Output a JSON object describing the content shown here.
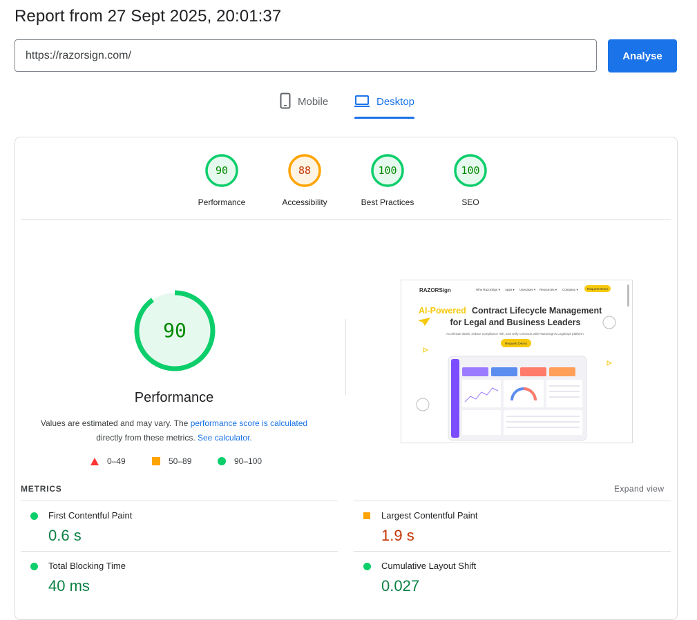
{
  "header": {
    "title": "Report from 27 Sept 2025, 20:01:37",
    "url_value": "https://razorsign.com/",
    "analyse_label": "Analyse"
  },
  "tabs": [
    {
      "label": "Mobile",
      "icon": "phone-icon",
      "active": false
    },
    {
      "label": "Desktop",
      "icon": "laptop-icon",
      "active": true
    }
  ],
  "scores": [
    {
      "label": "Performance",
      "value": "90",
      "status": "pass",
      "color": "#0cce6b"
    },
    {
      "label": "Accessibility",
      "value": "88",
      "status": "average",
      "color": "#ffa400"
    },
    {
      "label": "Best Practices",
      "value": "100",
      "status": "pass",
      "color": "#0cce6b"
    },
    {
      "label": "SEO",
      "value": "100",
      "status": "pass",
      "color": "#0cce6b"
    }
  ],
  "performance": {
    "score": "90",
    "label": "Performance",
    "note_1": "Values are estimated and may vary. The",
    "note_link_1": "performance score is calculated",
    "note_2": "directly from these metrics.",
    "note_link_2": "See calculator."
  },
  "legend": [
    {
      "icon": "triangle-icon",
      "label": "0–49",
      "color": "#ff3333"
    },
    {
      "icon": "square-icon",
      "label": "50–89",
      "color": "#ffa400"
    },
    {
      "icon": "circle-icon",
      "label": "90–100",
      "color": "#0cce6b"
    }
  ],
  "metrics": {
    "title": "METRICS",
    "expand_label": "Expand view",
    "items": [
      {
        "name": "First Contentful Paint",
        "value": "0.6 s",
        "status": "pass"
      },
      {
        "name": "Largest Contentful Paint",
        "value": "1.9 s",
        "status": "average"
      },
      {
        "name": "Total Blocking Time",
        "value": "40 ms",
        "status": "pass"
      },
      {
        "name": "Cumulative Layout Shift",
        "value": "0.027",
        "status": "pass"
      }
    ]
  },
  "screenshot": {
    "logo": "RAZORSign",
    "nav": [
      "Why RazorSign ▾",
      "Apps ▾",
      "Usecases ▾",
      "Resources ▾",
      "Company ▾"
    ],
    "cta": "Request Demo",
    "headline_accent": "AI-Powered",
    "headline_1": "Contract Lifecycle Management",
    "headline_2": "for Legal and Business Leaders",
    "subtext": "Accelerate deals, reduce compliance risk, and unify contracts with RazorSign's LegalOps platform.",
    "button": "Request Demo"
  },
  "colors": {
    "accent": "#1a73e8",
    "pass": "#0cce6b",
    "average": "#ffa400",
    "fail": "#ff3333",
    "screenshot_yellow": "#f6c90e"
  }
}
